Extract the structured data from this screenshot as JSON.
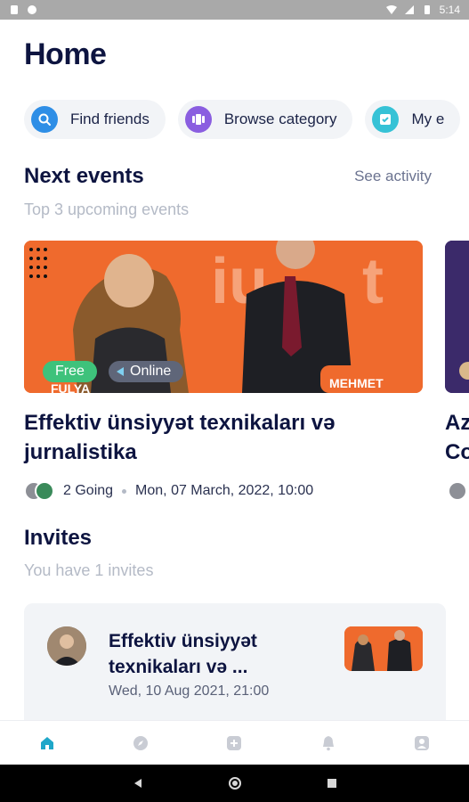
{
  "status_bar": {
    "time": "5:14"
  },
  "header": {
    "title": "Home"
  },
  "chips": [
    {
      "label": "Find friends",
      "icon": "search-icon",
      "color": "#2e8ee6"
    },
    {
      "label": "Browse category",
      "icon": "category-icon",
      "color": "#8a5ee0"
    },
    {
      "label": "My e",
      "icon": "check-icon",
      "color": "#36c2d6"
    }
  ],
  "next_events": {
    "title": "Next events",
    "see_activity": "See activity",
    "subtitle": "Top 3 upcoming events",
    "event": {
      "badge_free": "Free",
      "badge_online": "Online",
      "title": "Effektiv ünsiyyət texnikaları və jurnalistika",
      "going": "2 Going",
      "date": "Mon, 07 March, 2022, 10:00",
      "banner_name_left": "FULYA",
      "banner_name_right": "MEHMET"
    },
    "event2_title": "Az\nCo"
  },
  "invites": {
    "title": "Invites",
    "subtitle": "You have 1 invites",
    "card": {
      "title": "Effektiv ünsiyyət texnikaları və ...",
      "date": "Wed, 10 Aug 2021, 21:00"
    }
  },
  "colors": {
    "brand": "#0d1440",
    "accent": "#1fa7c9",
    "orange": "#ef6a2d"
  }
}
